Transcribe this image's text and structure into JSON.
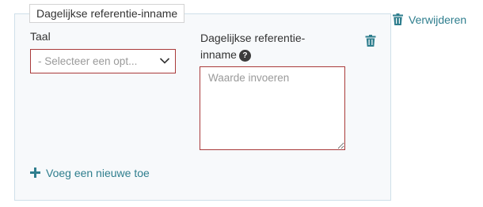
{
  "fieldset": {
    "legend": "Dagelijkse referentie-inname"
  },
  "row": {
    "language_label": "Taal",
    "language_select": {
      "selected": "- Selecteer een opt..."
    },
    "value_label": "Dagelijkse referentie-inname",
    "help_icon_text": "?",
    "value_input": {
      "value": "",
      "placeholder": "Waarde invoeren"
    }
  },
  "actions": {
    "remove_label": "Verwijderen",
    "add_label": "Voeg een nieuwe toe"
  },
  "icons": {
    "trash": "trash-icon",
    "chevron": "chevron-down-icon",
    "help": "question-circle-icon",
    "plus": "plus-icon"
  },
  "colors": {
    "accent": "#2f7e8e",
    "error_border": "#a93a3a",
    "fieldset_border": "#cfe0ea",
    "fieldset_bg": "#f7f9fb",
    "placeholder": "#9a9a9a"
  }
}
